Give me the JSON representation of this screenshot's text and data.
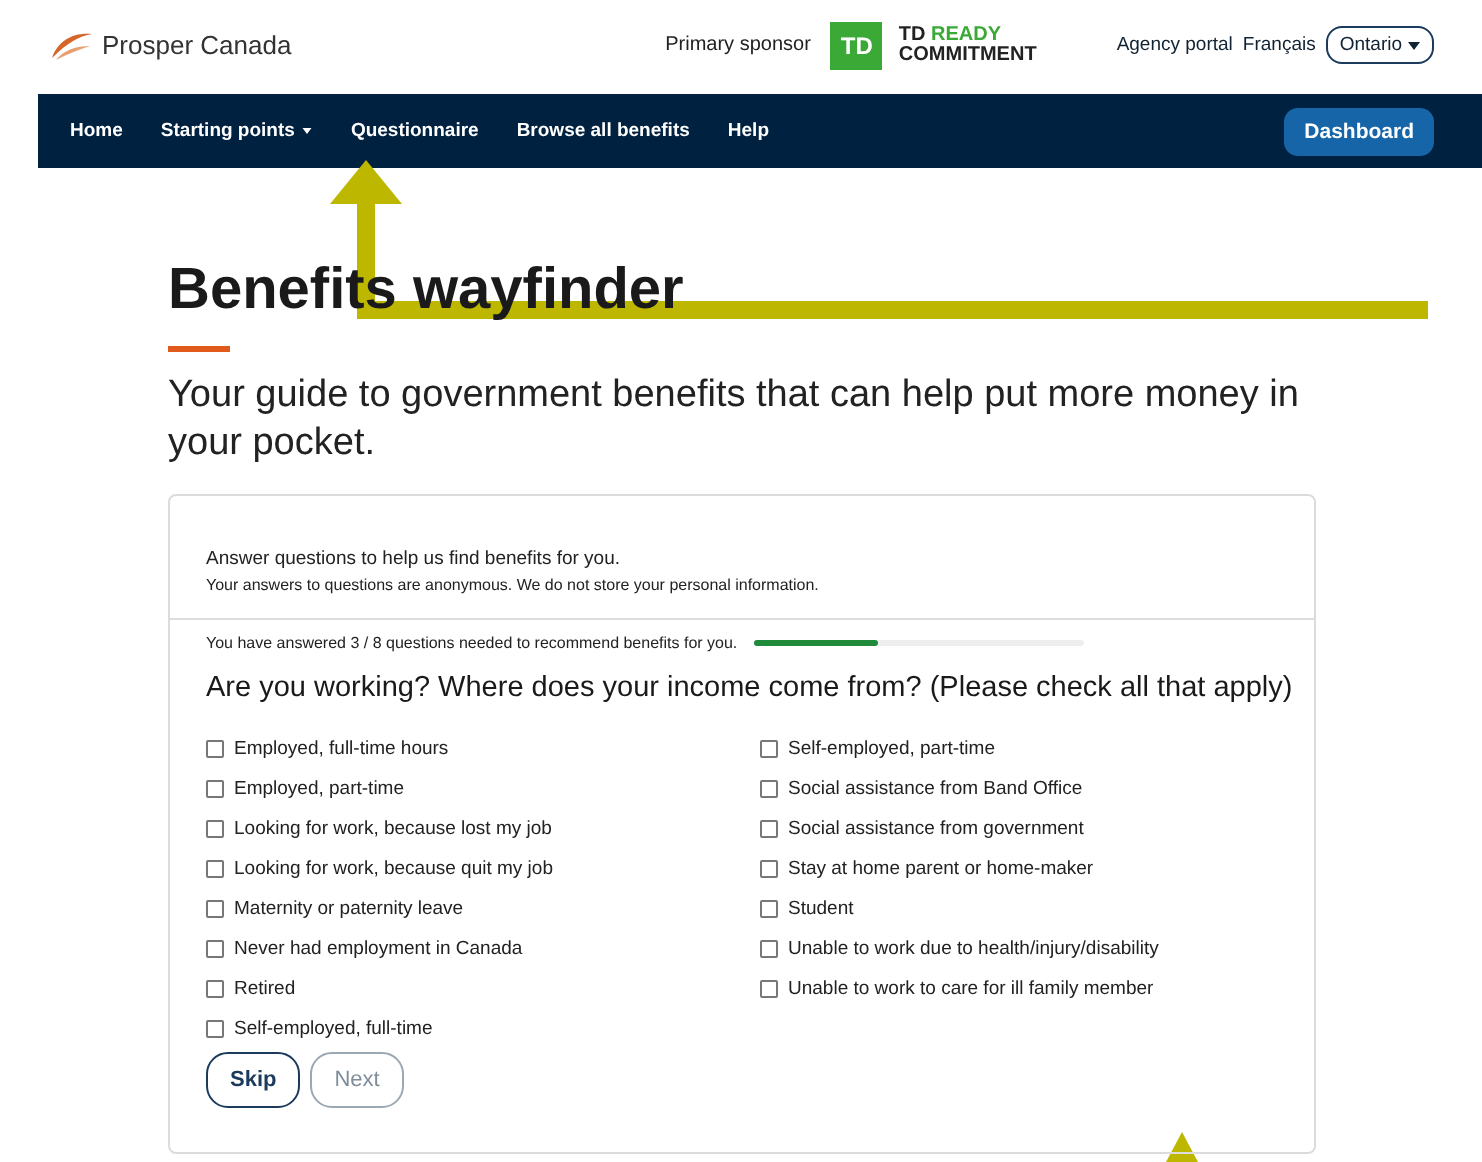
{
  "header": {
    "brand": "Prosper Canada",
    "sponsor_label": "Primary sponsor",
    "sponsor_logo": "TD",
    "sponsor_line1_a": "TD",
    "sponsor_line1_b": "READY",
    "sponsor_line2": "COMMITMENT",
    "links": [
      "Agency portal",
      "Français"
    ],
    "region": "Ontario"
  },
  "nav": {
    "items": [
      {
        "label": "Home",
        "kind": "link"
      },
      {
        "label": "Starting points",
        "kind": "dropdown"
      },
      {
        "label": "Questionnaire",
        "kind": "link"
      },
      {
        "label": "Browse all benefits",
        "kind": "link"
      },
      {
        "label": "Help",
        "kind": "link"
      }
    ],
    "action": "Dashboard"
  },
  "page": {
    "title": "Benefits wayfinder",
    "subtitle": "Your guide to government benefits that can help put more money in your pocket."
  },
  "card": {
    "intro": "Answer questions to help us find benefits for you.",
    "note": "Your answers to questions are anonymous. We do not store your personal information.",
    "progress_text": "You have answered 3 / 8 questions needed to recommend benefits for you.",
    "progress": {
      "level": 0.38
    },
    "question": "Are you working? Where does your income come from? (Please check all that apply)",
    "options": [
      {
        "label": "Employed, full-time hours",
        "checked": false
      },
      {
        "label": "Employed, part-time",
        "checked": false
      },
      {
        "label": "Looking for work, because lost my job",
        "checked": false
      },
      {
        "label": "Looking for work, because quit my job",
        "checked": false
      },
      {
        "label": "Maternity or paternity leave",
        "checked": false
      },
      {
        "label": "Never had employment in Canada",
        "checked": false
      },
      {
        "label": "Retired",
        "checked": false
      },
      {
        "label": "Self-employed, full-time",
        "checked": false
      },
      {
        "label": "Self-employed, part-time",
        "checked": false
      },
      {
        "label": "Social assistance from Band Office",
        "checked": false
      },
      {
        "label": "Social assistance from government",
        "checked": false
      },
      {
        "label": "Stay at home parent or home-maker",
        "checked": false
      },
      {
        "label": "Student",
        "checked": false
      },
      {
        "label": "Unable to work due to health/injury/disability",
        "checked": false
      },
      {
        "label": "Unable to work to care for ill family member",
        "checked": false
      }
    ],
    "buttons": [
      {
        "label": "Skip",
        "disabled": false
      },
      {
        "label": "Next",
        "disabled": true
      }
    ]
  }
}
